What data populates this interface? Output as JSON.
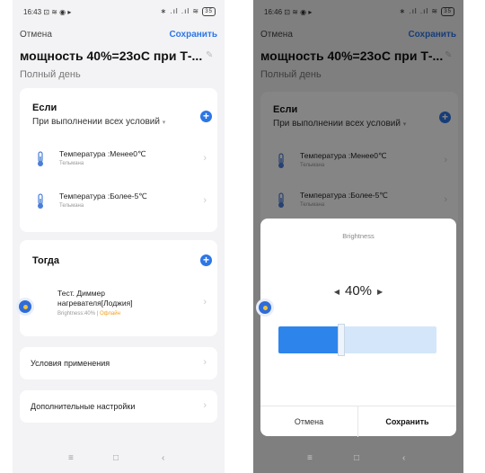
{
  "left": {
    "status": {
      "time": "16:43",
      "icons": "⊡ ≋ ◉ ▸",
      "signal": "∗ .ıl .ıl ≋",
      "battery": "35"
    },
    "header": {
      "cancel": "Отмена",
      "save": "Сохранить",
      "title": "мощность 40%=23оС при Т-...",
      "subtitle": "Полный день"
    },
    "if_section": {
      "title": "Если",
      "condition_mode": "При выполнении всех условий",
      "conditions": [
        {
          "title": "Температура :Менее0℃",
          "device": "Тельмана"
        },
        {
          "title": "Температура :Более-5℃",
          "device": "Тельмана"
        }
      ]
    },
    "then_section": {
      "title": "Тогда",
      "action": {
        "line1": "Тест. Диммер",
        "line2": "нагревателя[Лоджия]",
        "detail": "Brightness:40%",
        "separator": " | ",
        "status": "Офлайн"
      }
    },
    "rows": {
      "conditions_label": "Условия применения",
      "advanced_label": "Дополнительные настройки"
    },
    "nav": {
      "menu": "≡",
      "home": "□",
      "back": "‹"
    }
  },
  "right": {
    "status": {
      "time": "16:46",
      "icons": "⊡ ≋ ◉ ▸",
      "signal": "∗ .ıl .ıl ≋",
      "battery": "35"
    },
    "dialog": {
      "title": "Brightness",
      "value": "40%",
      "value_fraction": 0.4,
      "cancel": "Отмена",
      "save": "Сохранить"
    }
  },
  "colors": {
    "accent": "#2d76e6",
    "offline": "#f0a020",
    "slider_fill": "#2d85ec",
    "slider_track": "#d4e6fa"
  }
}
